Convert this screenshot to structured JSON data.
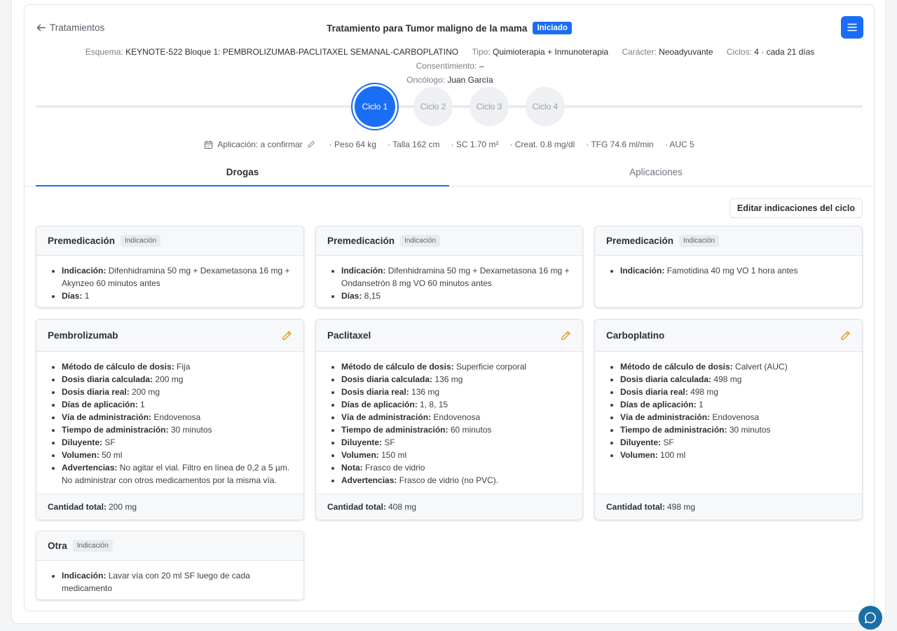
{
  "header": {
    "back_label": "Tratamientos",
    "title": "Tratamiento para Tumor maligno de la mama",
    "status_badge": "Iniciado"
  },
  "meta": [
    {
      "label": "Esquema:",
      "value": "KEYNOTE-522 Bloque 1: PEMBROLIZUMAB-PACLITAXEL SEMANAL-CARBOPLATINO"
    },
    {
      "label": "Tipo:",
      "value": "Quimioterapia + Inmunoterapia"
    },
    {
      "label": "Carácter:",
      "value": "Neoadyuvante"
    },
    {
      "label": "Ciclos:",
      "value": "4 · cada 21 días"
    },
    {
      "label": "Consentimiento:",
      "value": "–"
    },
    {
      "label": "Oncólogo:",
      "value": "Juan García"
    }
  ],
  "cycles": [
    "Ciclo 1",
    "Ciclo 2",
    "Ciclo 3",
    "Ciclo 4"
  ],
  "vitals": {
    "application": "Aplicación: a confirmar",
    "peso": "· Peso 64 kg",
    "talla": "· Talla 162 cm",
    "sc": "· SC 1.70 m²",
    "creat": "· Creat. 0.8 mg/dl",
    "tfg": "· TFG 74.6 ml/min",
    "auc": "· AUC 5"
  },
  "tabs": [
    "Drogas",
    "Aplicaciones"
  ],
  "edit_indications_label": "Editar indicaciones del ciclo",
  "tag_label": "Indicación",
  "premeds": [
    {
      "title": "Premedicación",
      "items": [
        {
          "k": "Indicación:",
          "v": "Difenhidramina 50 mg + Dexametasona 16 mg + Akynzeo 60 minutos antes"
        },
        {
          "k": "Días:",
          "v": "1"
        }
      ]
    },
    {
      "title": "Premedicación",
      "items": [
        {
          "k": "Indicación:",
          "v": "Difenhidramina 50 mg + Dexametasona 16 mg + Ondansetrón 8 mg VO 60 minutos antes"
        },
        {
          "k": "Días:",
          "v": "8,15"
        }
      ]
    },
    {
      "title": "Premedicación",
      "items": [
        {
          "k": "Indicación:",
          "v": "Famotidina 40 mg VO 1 hora antes"
        }
      ]
    }
  ],
  "drugs": [
    {
      "title": "Pembrolizumab",
      "items": [
        {
          "k": "Método de cálculo de dosis:",
          "v": "Fija"
        },
        {
          "k": "Dosis diaria calculada:",
          "v": "200 mg"
        },
        {
          "k": "Dosis diaria real:",
          "v": "200 mg"
        },
        {
          "k": "Días de aplicación:",
          "v": "1"
        },
        {
          "k": "Vía de administración:",
          "v": "Endovenosa"
        },
        {
          "k": "Tiempo de administración:",
          "v": "30 minutos"
        },
        {
          "k": "Diluyente:",
          "v": "SF"
        },
        {
          "k": "Volumen:",
          "v": "50 ml"
        },
        {
          "k": "Advertencias:",
          "v": "No agitar el vial. Filtro en línea de 0,2 a 5 µm. No administrar con otros medicamentos por la misma vía."
        }
      ],
      "total_label": "Cantidad total:",
      "total": "200 mg"
    },
    {
      "title": "Paclitaxel",
      "items": [
        {
          "k": "Método de cálculo de dosis:",
          "v": "Superficie corporal"
        },
        {
          "k": "Dosis diaria calculada:",
          "v": "136 mg"
        },
        {
          "k": "Dosis diaria real:",
          "v": "136 mg"
        },
        {
          "k": "Días de aplicación:",
          "v": "1, 8, 15"
        },
        {
          "k": "Vía de administración:",
          "v": "Endovenosa"
        },
        {
          "k": "Tiempo de administración:",
          "v": "60 minutos"
        },
        {
          "k": "Diluyente:",
          "v": "SF"
        },
        {
          "k": "Volumen:",
          "v": "150 ml"
        },
        {
          "k": "Nota:",
          "v": "Frasco de vidrio"
        },
        {
          "k": "Advertencias:",
          "v": "Frasco de vidrio (no PVC)."
        }
      ],
      "total_label": "Cantidad total:",
      "total": "408 mg"
    },
    {
      "title": "Carboplatino",
      "items": [
        {
          "k": "Método de cálculo de dosis:",
          "v": "Calvert (AUC)"
        },
        {
          "k": "Dosis diaria calculada:",
          "v": "498 mg"
        },
        {
          "k": "Dosis diaria real:",
          "v": "498 mg"
        },
        {
          "k": "Días de aplicación:",
          "v": "1"
        },
        {
          "k": "Vía de administración:",
          "v": "Endovenosa"
        },
        {
          "k": "Tiempo de administración:",
          "v": "30 minutos"
        },
        {
          "k": "Diluyente:",
          "v": "SF"
        },
        {
          "k": "Volumen:",
          "v": "100 ml"
        }
      ],
      "total_label": "Cantidad total:",
      "total": "498 mg"
    }
  ],
  "other": {
    "title": "Otra",
    "items": [
      {
        "k": "Indicación:",
        "v": "Lavar vía con 20 ml SF luego de cada medicamento"
      }
    ]
  },
  "colors": {
    "accent": "#1a6ef5",
    "pencil": "#e0a020",
    "chat": "#1b6fa8"
  }
}
